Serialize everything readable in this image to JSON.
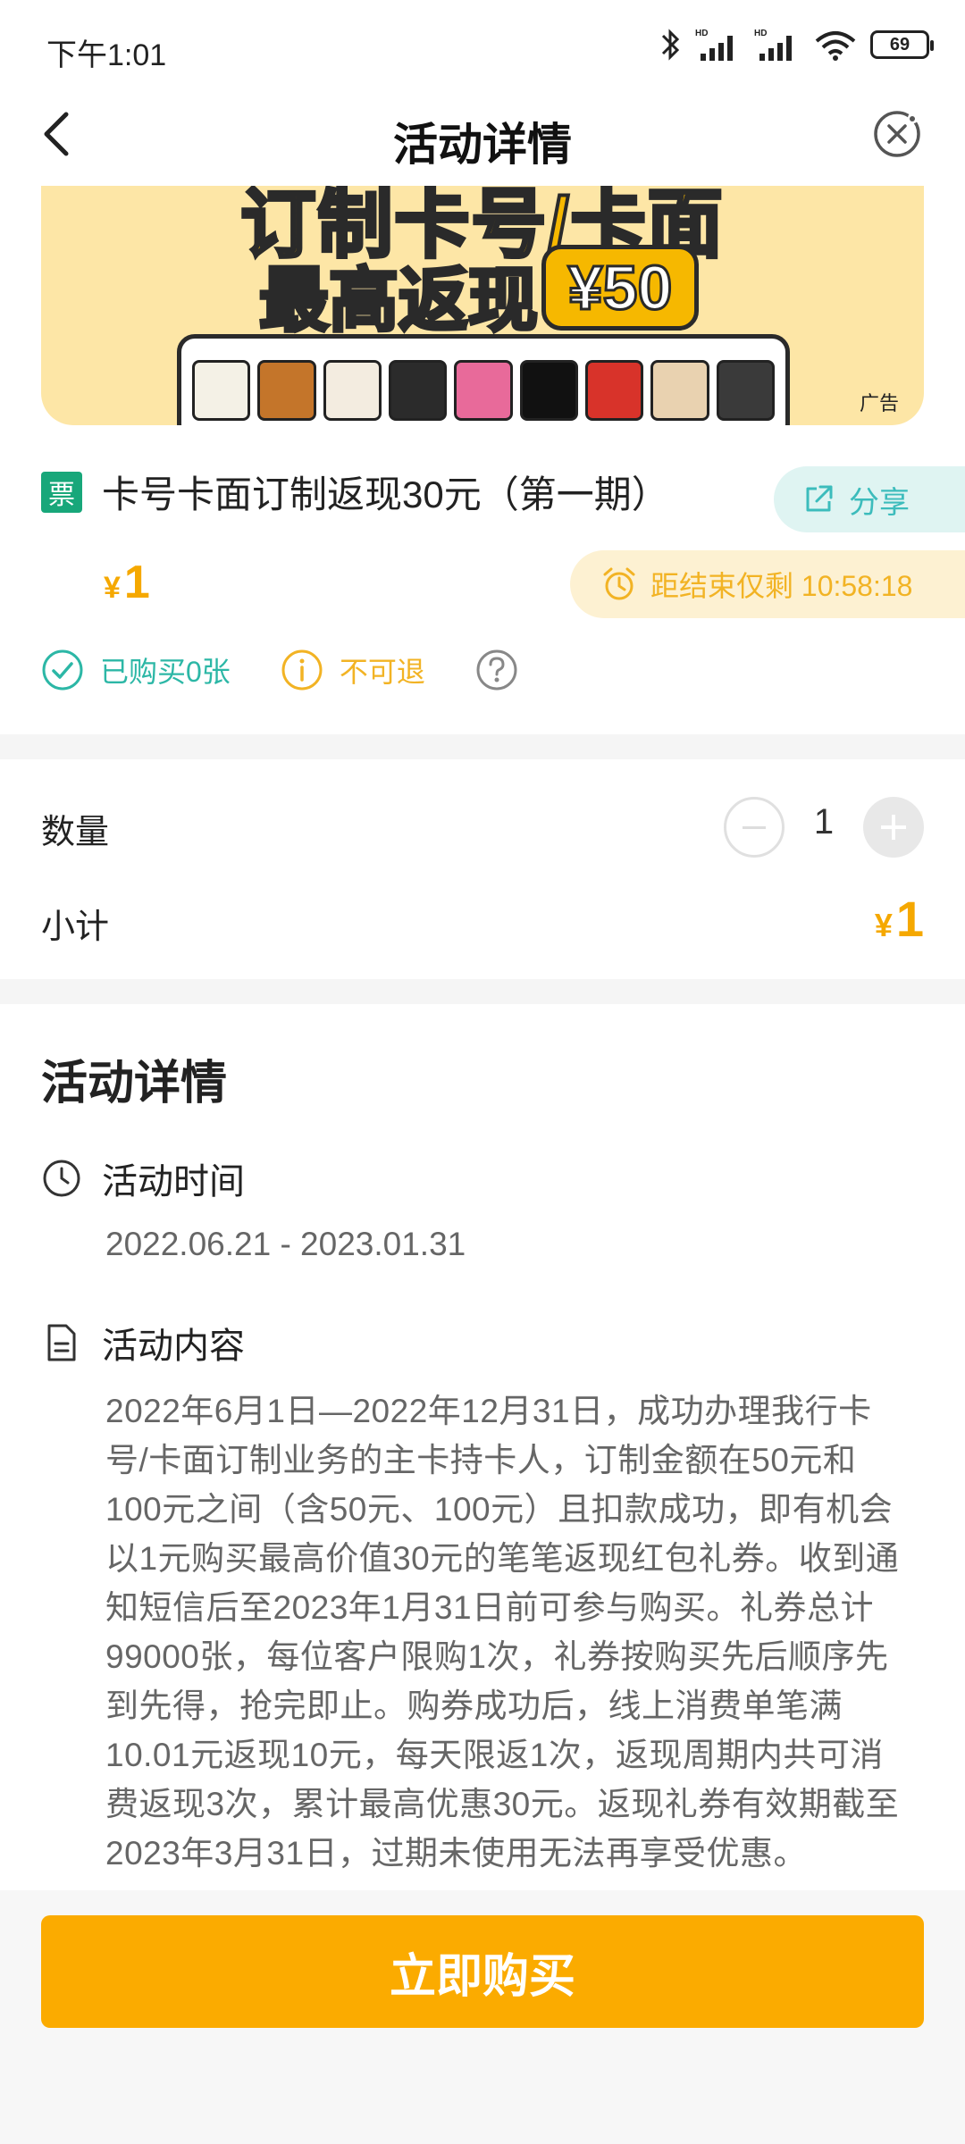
{
  "status_bar": {
    "time": "下午1:01",
    "battery": "69"
  },
  "nav": {
    "title": "活动详情"
  },
  "banner": {
    "line1": "订制卡号/卡面",
    "line2": "最高返现",
    "amount": "¥50",
    "ad_label": "广告"
  },
  "product": {
    "badge": "票",
    "title": "卡号卡面订制返现30元（第一期）",
    "share_label": "分享",
    "price_symbol": "¥",
    "price": "1",
    "countdown": "距结束仅剩 10:58:18",
    "bought_label": "已购买0张",
    "refund_label": "不可退"
  },
  "order": {
    "quantity_label": "数量",
    "quantity": "1",
    "subtotal_label": "小计",
    "subtotal_symbol": "¥",
    "subtotal": "1"
  },
  "details": {
    "section_title": "活动详情",
    "time_label": "活动时间",
    "time_value": "2022.06.21 - 2023.01.31",
    "content_label": "活动内容",
    "content_text": "2022年6月1日—2022年12月31日，成功办理我行卡号/卡面订制业务的主卡持卡人，订制金额在50元和100元之间（含50元、100元）且扣款成功，即有机会以1元购买最高价值30元的笔笔返现红包礼券。收到通知短信后至2023年1月31日前可参与购买。礼券总计99000张，每位客户限购1次，礼券按购买先后顺序先到先得，抢完即止。购券成功后，线上消费单笔满10.01元返现10元，每天限返1次，返现周期内共可消费返现3次，累计最高优惠30元。返现礼券有效期截至2023年3月31日，过期未使用无法再享受优惠。"
  },
  "bottom": {
    "buy_label": "立即购买"
  },
  "colors": {
    "accent_orange": "#fbab00",
    "price_orange": "#f5a800",
    "teal": "#2cb7a6",
    "ticket_green": "#18a77a"
  }
}
